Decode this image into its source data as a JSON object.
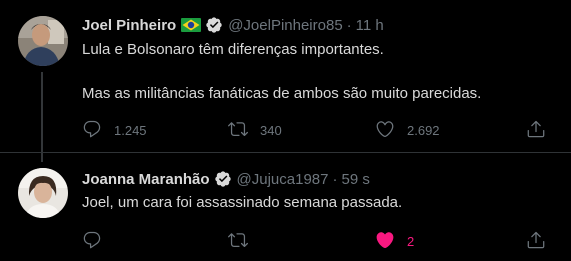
{
  "colors": {
    "background": "#000000",
    "text": "#d9d9d9",
    "muted": "#6e767d",
    "verified": "#d9d9d9",
    "like_active": "#f91880",
    "divider": "#2f3336"
  },
  "tweets": [
    {
      "author_name": "Joel Pinheiro",
      "flag_icon": "brazil-flag-icon",
      "verified_icon": "verified-badge-icon",
      "handle": "@JoelPinheiro85",
      "separator": "·",
      "time": "11 h",
      "text_lines": [
        "Lula e Bolsonaro têm diferenças importantes.",
        "Mas as militâncias fanáticas de ambos são muito parecidas."
      ],
      "reply_count": "1.245",
      "retweet_count": "340",
      "like_count": "2.692"
    },
    {
      "author_name": "Joanna Maranhão",
      "verified_icon": "verified-badge-icon",
      "handle": "@Jujuca1987",
      "separator": "·",
      "time": "59 s",
      "text_lines": [
        "Joel, um cara foi assassinado semana passada."
      ],
      "reply_count": "",
      "retweet_count": "",
      "like_count": "2",
      "liked": true
    }
  ]
}
